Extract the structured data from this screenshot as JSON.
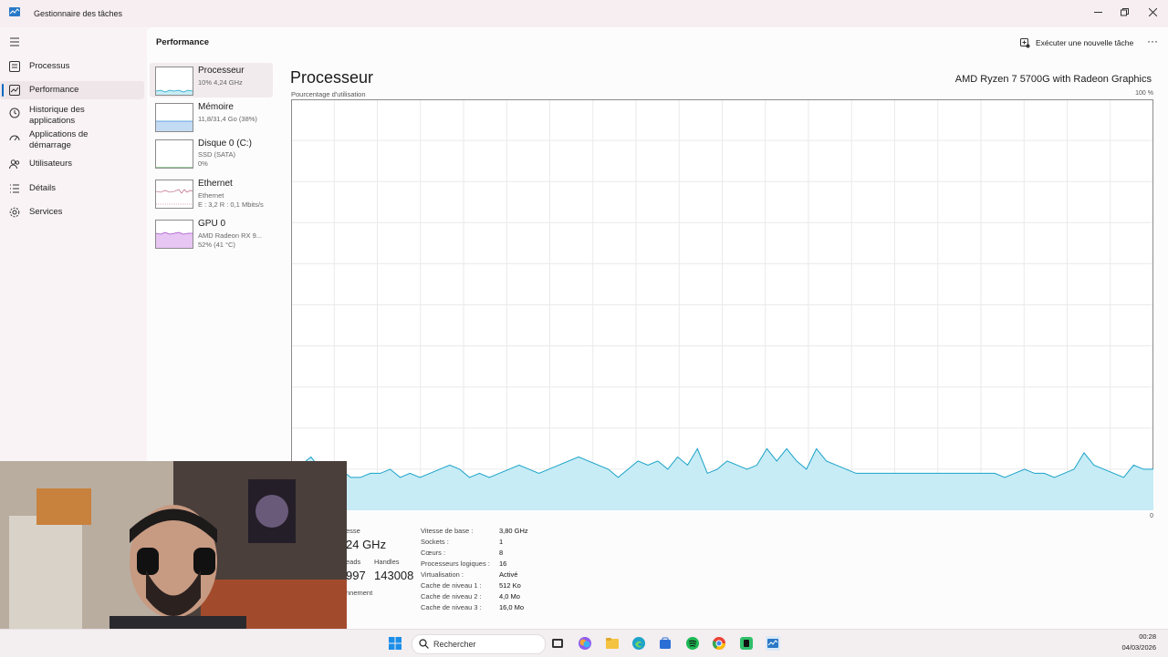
{
  "window": {
    "title": "Gestionnaire des tâches",
    "icons": [
      "minimize-icon",
      "restore-icon",
      "close-icon"
    ]
  },
  "nav": {
    "items": [
      {
        "label": "Processus",
        "icon": "process-icon"
      },
      {
        "label": "Performance",
        "icon": "performance-icon",
        "active": true
      },
      {
        "label": "Historique des applications",
        "icon": "history-icon"
      },
      {
        "label": "Applications de démarrage",
        "icon": "startup-icon"
      },
      {
        "label": "Utilisateurs",
        "icon": "users-icon"
      },
      {
        "label": "Détails",
        "icon": "details-icon"
      },
      {
        "label": "Services",
        "icon": "services-icon"
      }
    ]
  },
  "header": {
    "title": "Performance",
    "new_task": "Exécuter une nouvelle tâche",
    "more": "···"
  },
  "resources": [
    {
      "title": "Processeur",
      "lines": [
        "10% 4,24 GHz"
      ],
      "color": "#1aa2c8"
    },
    {
      "title": "Mémoire",
      "lines": [
        "11,8/31,4 Go (38%)"
      ],
      "color": "#3b8fd6"
    },
    {
      "title": "Disque 0 (C:)",
      "lines": [
        "SSD (SATA)",
        "0%"
      ],
      "color": "#4aa34a"
    },
    {
      "title": "Ethernet",
      "lines": [
        "Ethernet",
        "E : 3,2 R : 0,1 Mbits/s"
      ],
      "color": "#b0456a"
    },
    {
      "title": "GPU 0",
      "lines": [
        "AMD Radeon RX 9...",
        "52% (41 °C)"
      ],
      "color": "#a552c9"
    }
  ],
  "cpu": {
    "title": "Processeur",
    "model": "AMD Ryzen 7 5700G with Radeon Graphics",
    "y_label": "Pourcentage d'utilisation",
    "y_max": "100 %",
    "y_min": "0",
    "fill_color": "#c7ecf5",
    "line_color": "#1aa2c8",
    "left_stats": {
      "speed_label": "esse",
      "speed_value": "24 GHz",
      "threads_label": "eads",
      "threads_value": "997",
      "handles_label": "Handles",
      "handles_value": "143008",
      "uptime_label": "nnement"
    },
    "specs": [
      {
        "k": "Vitesse de base :",
        "v": "3,80 GHz"
      },
      {
        "k": "Sockets :",
        "v": "1"
      },
      {
        "k": "Cœurs :",
        "v": "8"
      },
      {
        "k": "Processeurs logiques :",
        "v": "16"
      },
      {
        "k": "Virtualisation :",
        "v": "Activé"
      },
      {
        "k": "Cache de niveau 1 :",
        "v": "512 Ko"
      },
      {
        "k": "Cache de niveau 2 :",
        "v": "4,0 Mo"
      },
      {
        "k": "Cache de niveau 3 :",
        "v": "16,0 Mo"
      }
    ]
  },
  "chart_data": {
    "type": "area",
    "ylim": [
      0,
      100
    ],
    "values": [
      10,
      11,
      13,
      10,
      8,
      10,
      8,
      8,
      9,
      9,
      10,
      8,
      9,
      8,
      9,
      10,
      11,
      10,
      8,
      9,
      8,
      9,
      10,
      11,
      10,
      9,
      10,
      11,
      12,
      13,
      12,
      11,
      10,
      8,
      10,
      12,
      11,
      12,
      10,
      13,
      11,
      15,
      9,
      10,
      12,
      11,
      10,
      11,
      15,
      12,
      15,
      12,
      10,
      15,
      12,
      11,
      10,
      9,
      9,
      9,
      9,
      9,
      9,
      9,
      9,
      9,
      9,
      9,
      9,
      9,
      9,
      9,
      8,
      9,
      10,
      9,
      9,
      8,
      9,
      10,
      14,
      11,
      10,
      9,
      8,
      11,
      10,
      10
    ]
  },
  "taskbar": {
    "search_placeholder": "Rechercher",
    "apps": [
      "windows-start-icon",
      "task-view-icon",
      "copilot-icon",
      "file-explorer-icon",
      "edge-icon",
      "store-icon",
      "spotify-icon",
      "chrome-icon",
      "app-green-icon",
      "task-manager-icon"
    ],
    "time": "00:28",
    "date": "04/03/2026"
  }
}
